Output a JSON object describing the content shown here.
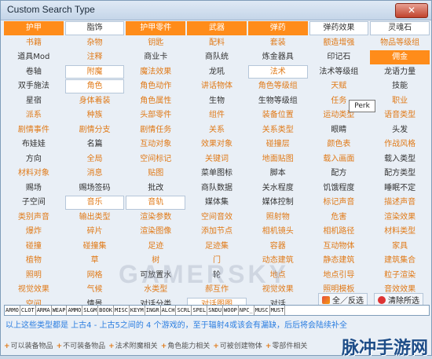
{
  "window": {
    "title": "Custom Search Type"
  },
  "cells": [
    {
      "t": "护甲",
      "o": 1,
      "b": 0,
      "s": 1
    },
    {
      "t": "脂饰",
      "o": 0,
      "b": 1
    },
    {
      "t": "护甲零件",
      "o": 1,
      "b": 0,
      "s": 1
    },
    {
      "t": "武器",
      "o": 1,
      "b": 0,
      "s": 1
    },
    {
      "t": "弹药",
      "o": 1,
      "b": 0,
      "s": 1
    },
    {
      "t": "弹药效果",
      "o": 0,
      "b": 1
    },
    {
      "t": "灵魂石",
      "o": 0,
      "b": 1
    },
    {
      "t": "书籍",
      "o": 1
    },
    {
      "t": "杂物",
      "o": 1
    },
    {
      "t": "钥匙",
      "o": 1
    },
    {
      "t": "配料",
      "o": 1
    },
    {
      "t": "套装",
      "o": 1
    },
    {
      "t": "额造增强",
      "o": 1
    },
    {
      "t": "物品等级组",
      "o": 1
    },
    {
      "t": "道具Mod",
      "o": 0
    },
    {
      "t": "注释",
      "o": 1
    },
    {
      "t": "商业卡",
      "o": 0
    },
    {
      "t": "商队统",
      "o": 0
    },
    {
      "t": "炼金器具",
      "o": 0
    },
    {
      "t": "印记石",
      "o": 0
    },
    {
      "t": "佣金",
      "o": 0,
      "s": 1
    },
    {
      "t": "卷轴",
      "o": 0
    },
    {
      "t": "附魔",
      "o": 1,
      "b": 1
    },
    {
      "t": "魔法效果",
      "o": 1
    },
    {
      "t": "龙吼",
      "o": 0
    },
    {
      "t": "法术",
      "o": 1,
      "b": 1
    },
    {
      "t": "法术等级组",
      "o": 0
    },
    {
      "t": "龙语力量",
      "o": 0
    },
    {
      "t": "双手施法",
      "o": 0
    },
    {
      "t": "角色",
      "o": 1,
      "b": 1
    },
    {
      "t": "角色动作",
      "o": 1
    },
    {
      "t": "讲话物体",
      "o": 1
    },
    {
      "t": "角色等级组",
      "o": 1
    },
    {
      "t": "天赋",
      "o": 1
    },
    {
      "t": "技能",
      "o": 0
    },
    {
      "t": "星宿",
      "o": 0
    },
    {
      "t": "身体着装",
      "o": 1
    },
    {
      "t": "角色属性",
      "o": 1
    },
    {
      "t": "生物",
      "o": 0
    },
    {
      "t": "生物等级组",
      "o": 0
    },
    {
      "t": "任务",
      "o": 1
    },
    {
      "t": "职业",
      "o": 1
    },
    {
      "t": "派系",
      "o": 1
    },
    {
      "t": "种族",
      "o": 1
    },
    {
      "t": "头部零件",
      "o": 1
    },
    {
      "t": "组件",
      "o": 1
    },
    {
      "t": "装备位置",
      "o": 1
    },
    {
      "t": "运动类型",
      "o": 1
    },
    {
      "t": "语音类型",
      "o": 1
    },
    {
      "t": "剧情事件",
      "o": 1
    },
    {
      "t": "剧情分支",
      "o": 1
    },
    {
      "t": "剧情任务",
      "o": 1
    },
    {
      "t": "关系",
      "o": 1
    },
    {
      "t": "关系类型",
      "o": 1
    },
    {
      "t": "眼睛",
      "o": 0
    },
    {
      "t": "头发",
      "o": 0
    },
    {
      "t": "布娃娃",
      "o": 0
    },
    {
      "t": "名篇",
      "o": 0
    },
    {
      "t": "互动对象",
      "o": 1
    },
    {
      "t": "效果对象",
      "o": 1
    },
    {
      "t": "碰撞层",
      "o": 1
    },
    {
      "t": "颜色表",
      "o": 1
    },
    {
      "t": "作战风格",
      "o": 1
    },
    {
      "t": "方向",
      "o": 0
    },
    {
      "t": "全局",
      "o": 1
    },
    {
      "t": "空间标记",
      "o": 1
    },
    {
      "t": "关键词",
      "o": 1
    },
    {
      "t": "地面贴图",
      "o": 1
    },
    {
      "t": "载入画面",
      "o": 1
    },
    {
      "t": "载入类型",
      "o": 0
    },
    {
      "t": "材料对象",
      "o": 1
    },
    {
      "t": "消息",
      "o": 1
    },
    {
      "t": "贴图",
      "o": 1
    },
    {
      "t": "菜单图标",
      "o": 0
    },
    {
      "t": "脚本",
      "o": 0
    },
    {
      "t": "配方",
      "o": 0
    },
    {
      "t": "配方类型",
      "o": 0
    },
    {
      "t": "赐场",
      "o": 0
    },
    {
      "t": "赐场签码",
      "o": 0
    },
    {
      "t": "批改",
      "o": 0
    },
    {
      "t": "商队数据",
      "o": 0
    },
    {
      "t": "关水程度",
      "o": 0
    },
    {
      "t": "饥饿程度",
      "o": 0
    },
    {
      "t": "睡眠不定",
      "o": 0
    },
    {
      "t": "子空间",
      "o": 0
    },
    {
      "t": "音乐",
      "o": 1,
      "b": 1
    },
    {
      "t": "音轨",
      "o": 1,
      "b": 1
    },
    {
      "t": "媒体集",
      "o": 0
    },
    {
      "t": "媒体控制",
      "o": 0
    },
    {
      "t": "标记声音",
      "o": 1
    },
    {
      "t": "描述声音",
      "o": 1
    },
    {
      "t": "类别声音",
      "o": 1
    },
    {
      "t": "输出类型",
      "o": 1
    },
    {
      "t": "渲染参数",
      "o": 1
    },
    {
      "t": "空间音效",
      "o": 1
    },
    {
      "t": "照射物",
      "o": 1
    },
    {
      "t": "危害",
      "o": 1
    },
    {
      "t": "渲染效果",
      "o": 1
    },
    {
      "t": "爆炸",
      "o": 1
    },
    {
      "t": "碎片",
      "o": 1
    },
    {
      "t": "渲染图像",
      "o": 1
    },
    {
      "t": "添加节点",
      "o": 1
    },
    {
      "t": "相机镜头",
      "o": 1
    },
    {
      "t": "相机路径",
      "o": 1
    },
    {
      "t": "材料类型",
      "o": 1
    },
    {
      "t": "碰撞",
      "o": 1
    },
    {
      "t": "碰撞集",
      "o": 1
    },
    {
      "t": "足迹",
      "o": 1
    },
    {
      "t": "足迹集",
      "o": 1
    },
    {
      "t": "容器",
      "o": 1
    },
    {
      "t": "互动物体",
      "o": 1
    },
    {
      "t": "家具",
      "o": 1
    },
    {
      "t": "植物",
      "o": 1
    },
    {
      "t": "草",
      "o": 1
    },
    {
      "t": "树",
      "o": 1
    },
    {
      "t": "门",
      "o": 1
    },
    {
      "t": "动态建筑",
      "o": 1
    },
    {
      "t": "静态建筑",
      "o": 1
    },
    {
      "t": "建筑集合",
      "o": 1
    },
    {
      "t": "照明",
      "o": 1
    },
    {
      "t": "网格",
      "o": 1
    },
    {
      "t": "可放置水",
      "o": 0
    },
    {
      "t": "轮",
      "o": 0
    },
    {
      "t": "地点",
      "o": 1
    },
    {
      "t": "地点引导",
      "o": 1
    },
    {
      "t": "粒子渲染",
      "o": 1
    },
    {
      "t": "视觉效果",
      "o": 1
    },
    {
      "t": "气候",
      "o": 1
    },
    {
      "t": "水类型",
      "o": 1
    },
    {
      "t": "郝互作",
      "o": 1
    },
    {
      "t": "视觉效果",
      "o": 1
    },
    {
      "t": "照明模板",
      "o": 1
    },
    {
      "t": "音效效果",
      "o": 1
    },
    {
      "t": "空间",
      "o": 1
    },
    {
      "t": "情景",
      "o": 0
    },
    {
      "t": "对话分类",
      "o": 0
    },
    {
      "t": "对话图图",
      "o": 1,
      "b": 1
    },
    {
      "t": "对话",
      "o": 0
    },
    {
      "t": "",
      "o": 0
    },
    {
      "t": "",
      "o": 0
    }
  ],
  "actions": {
    "select_all": "全／反选",
    "clear": "清除所选"
  },
  "abbr": [
    "ARMO",
    "CLOT",
    "ARMA",
    "WEAP",
    "AMMO",
    "SLGM",
    "BOOK",
    "MISC",
    "KEYM",
    "INGR",
    "ALCH",
    "SCRL",
    "SPEL",
    "SNDU",
    "WOOP",
    "NPC_",
    "MUSC",
    "MUST"
  ],
  "status": "以上这些类型都是 上古4 - 上古5之间的 4 个游戏的，至于辐射4或该会有漏缺，后后将会陆续补全",
  "tooltip": "Perk",
  "legend": [
    "可以装备物品",
    "不可装备物品",
    "法术附魔相关",
    "角色能力相关",
    "可被创建物体",
    "零部件相关"
  ],
  "watermark": "GAMERSKY",
  "brand": "脉冲手游网",
  "colors": {
    "accent": "#e07a18",
    "selected": "#ff8c1a",
    "status": "#2a7de0"
  }
}
